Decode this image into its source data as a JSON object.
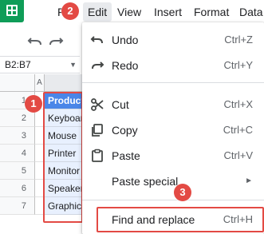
{
  "menubar": {
    "file_label": "F",
    "edit_label": "Edit",
    "view_label": "View",
    "insert_label": "Insert",
    "format_label": "Format",
    "data_label": "Data"
  },
  "name_box": {
    "value": "B2:B7"
  },
  "grid": {
    "column_a_label": "A",
    "rows": [
      {
        "num": "1",
        "value": "Product"
      },
      {
        "num": "2",
        "value": "Keyboard"
      },
      {
        "num": "3",
        "value": "Mouse"
      },
      {
        "num": "4",
        "value": "Printer"
      },
      {
        "num": "5",
        "value": "Monitor"
      },
      {
        "num": "6",
        "value": "Speaker"
      },
      {
        "num": "7",
        "value": "Graphics"
      }
    ]
  },
  "edit_menu": {
    "undo": {
      "label": "Undo",
      "shortcut": "Ctrl+Z"
    },
    "redo": {
      "label": "Redo",
      "shortcut": "Ctrl+Y"
    },
    "cut": {
      "label": "Cut",
      "shortcut": "Ctrl+X"
    },
    "copy": {
      "label": "Copy",
      "shortcut": "Ctrl+C"
    },
    "paste": {
      "label": "Paste",
      "shortcut": "Ctrl+V"
    },
    "paste_special": {
      "label": "Paste special",
      "arrow": "►"
    },
    "find_replace": {
      "label": "Find and replace",
      "shortcut": "Ctrl+H"
    }
  },
  "markers": {
    "m1": "1",
    "m2": "2",
    "m3": "3"
  },
  "colors": {
    "marker": "#e34a44",
    "header_fill": "#4a86e8",
    "selection_fill": "#e8f0fe",
    "app_logo": "#0f9d58"
  },
  "icons": {
    "logo": "sheets-logo-icon",
    "undo": "undo-icon",
    "redo": "redo-icon",
    "cut": "scissors-icon",
    "copy": "copy-icon",
    "paste": "clipboard-icon"
  }
}
